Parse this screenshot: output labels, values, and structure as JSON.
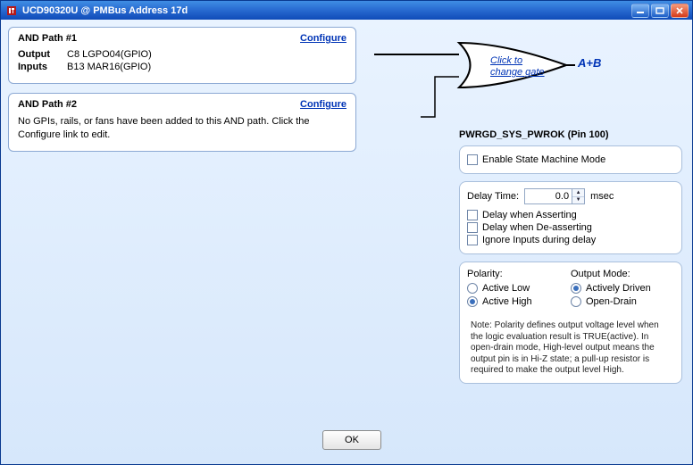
{
  "window": {
    "title": "UCD90320U @ PMBus Address 17d"
  },
  "and_paths": {
    "path1": {
      "title": "AND Path #1",
      "configure": "Configure",
      "output_label": "Output",
      "output_value": "C8 LGPO04(GPIO)",
      "inputs_label": "Inputs",
      "inputs_value": "B13 MAR16(GPIO)"
    },
    "path2": {
      "title": "AND Path #2",
      "configure": "Configure",
      "empty_msg": "No GPIs, rails, or fans have been added to this AND path. Click the Configure link to edit."
    }
  },
  "gate": {
    "link_line1": "Click to",
    "link_line2": "change gate",
    "expression": "A+B"
  },
  "output_panel": {
    "heading": "PWRGD_SYS_PWROK (Pin 100)",
    "enable_state_machine": "Enable State Machine Mode",
    "delay_time_label": "Delay Time:",
    "delay_time_value": "0.0",
    "delay_time_units": "msec",
    "delay_assert": "Delay when Asserting",
    "delay_deassert": "Delay when De-asserting",
    "ignore_inputs": "Ignore Inputs during delay",
    "polarity_heading": "Polarity:",
    "polarity_low": "Active Low",
    "polarity_high": "Active High",
    "output_mode_heading": "Output Mode:",
    "output_mode_driven": "Actively Driven",
    "output_mode_open": "Open-Drain",
    "note": "Note: Polarity defines output voltage level when the logic evaluation result is TRUE(active). In open-drain mode, High-level output means the output pin is in Hi-Z state; a pull-up resistor is required to make the output level High."
  },
  "buttons": {
    "ok": "OK"
  }
}
